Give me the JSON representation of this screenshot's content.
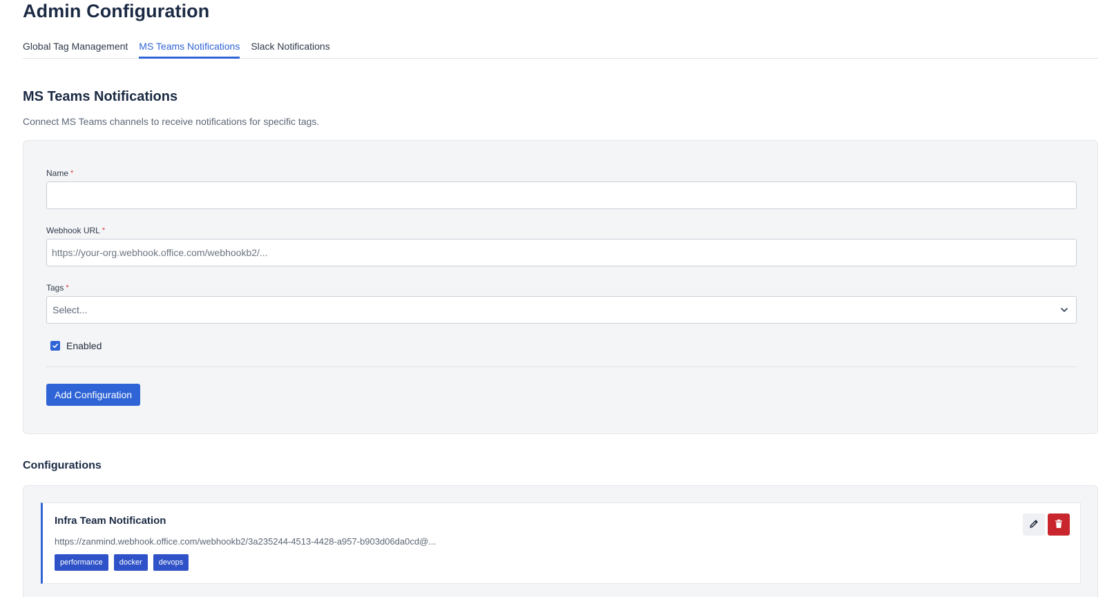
{
  "page": {
    "title": "Admin Configuration"
  },
  "tabs": [
    {
      "label": "Global Tag Management",
      "active": false
    },
    {
      "label": "MS Teams Notifications",
      "active": true
    },
    {
      "label": "Slack Notifications",
      "active": false
    }
  ],
  "section": {
    "title": "MS Teams Notifications",
    "description": "Connect MS Teams channels to receive notifications for specific tags."
  },
  "form": {
    "name": {
      "label": "Name",
      "required_mark": "*",
      "value": "",
      "placeholder": ""
    },
    "webhook": {
      "label": "Webhook URL",
      "required_mark": "*",
      "value": "",
      "placeholder": "https://your-org.webhook.office.com/webhookb2/..."
    },
    "tags": {
      "label": "Tags",
      "required_mark": "*",
      "placeholder": "Select..."
    },
    "enabled": {
      "label": "Enabled",
      "checked": true
    },
    "submit_label": "Add Configuration"
  },
  "configurations": {
    "title": "Configurations",
    "items": [
      {
        "name": "Infra Team Notification",
        "url": "https://zanmind.webhook.office.com/webhookb2/3a235244-4513-4428-a957-b903d06da0cd@...",
        "tags": [
          "performance",
          "docker",
          "devops"
        ]
      }
    ]
  },
  "icons": {
    "edit": "pencil-icon",
    "delete": "trash-icon",
    "select_arrow": "chevron-down-icon",
    "checkbox": "check-icon"
  },
  "colors": {
    "accent": "#2f64d6",
    "tag": "#2f52c8",
    "danger": "#c8262c",
    "required": "#d33a3a"
  }
}
